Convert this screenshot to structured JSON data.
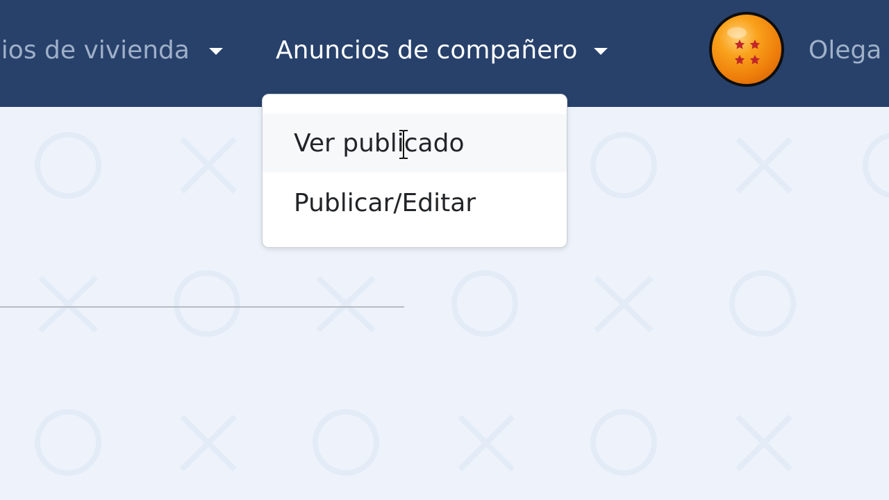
{
  "navbar": {
    "items": [
      {
        "label": "cios de vivienda"
      },
      {
        "label": "Anuncios de compañero"
      }
    ],
    "user_name": "Olega"
  },
  "dropdown": {
    "items": [
      {
        "label": "Ver publicado",
        "state": "hovered"
      },
      {
        "label": "Publicar/Editar"
      }
    ]
  },
  "icons": {
    "avatar": "dragon-ball-avatar-icon",
    "caret": "caret-down-icon",
    "cursor": "text-cursor-icon"
  },
  "colors": {
    "navbar_bg": "#27416b",
    "page_bg": "#eef3fb",
    "nav_active_text": "#ffffff",
    "nav_muted_text": "#9fb0c8",
    "dropdown_text": "#222427",
    "avatar_orange": "#f9a21c",
    "avatar_star": "#c0262a"
  }
}
